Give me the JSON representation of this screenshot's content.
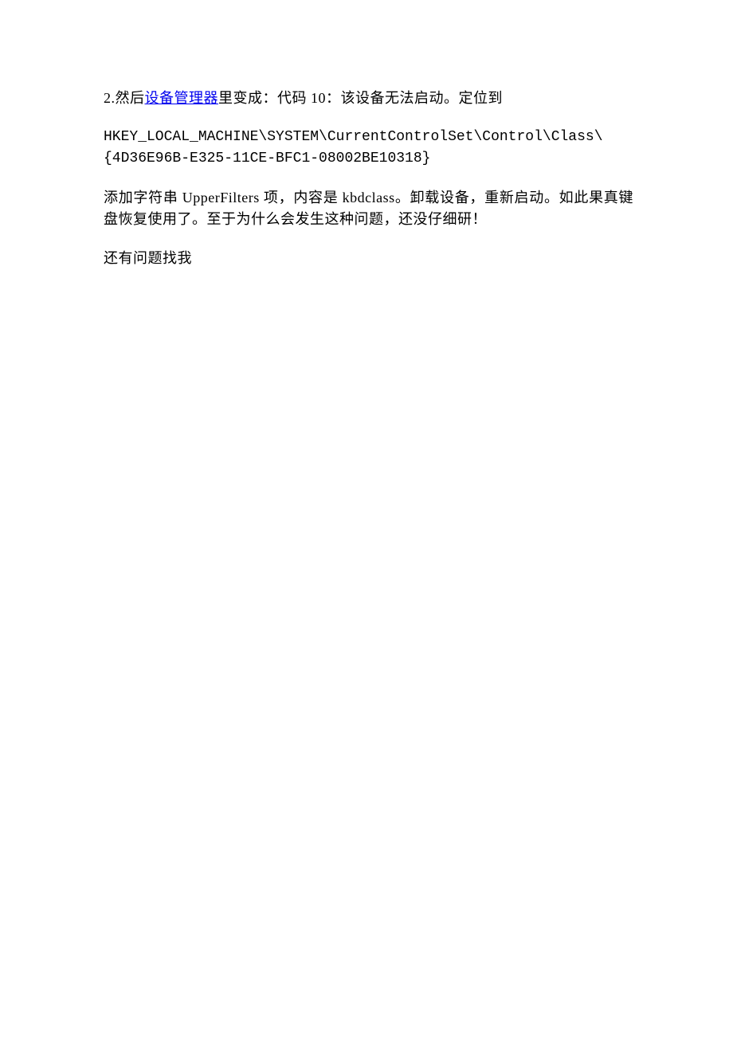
{
  "content": {
    "p1_prefix": "2.然后",
    "p1_link": "设备管理器",
    "p1_suffix": "里变成：代码 10：该设备无法启动。定位到",
    "p2": "HKEY_LOCAL_MACHINE\\SYSTEM\\CurrentControlSet\\Control\\Class\\{4D36E96B-E325-11CE-BFC1-08002BE10318}",
    "p3": "添加字符串 UpperFilters 项，内容是 kbdclass。卸载设备，重新启动。如此果真键盘恢复使用了。至于为什么会发生这种问题，还没仔细研！",
    "p4": "还有问题找我"
  }
}
